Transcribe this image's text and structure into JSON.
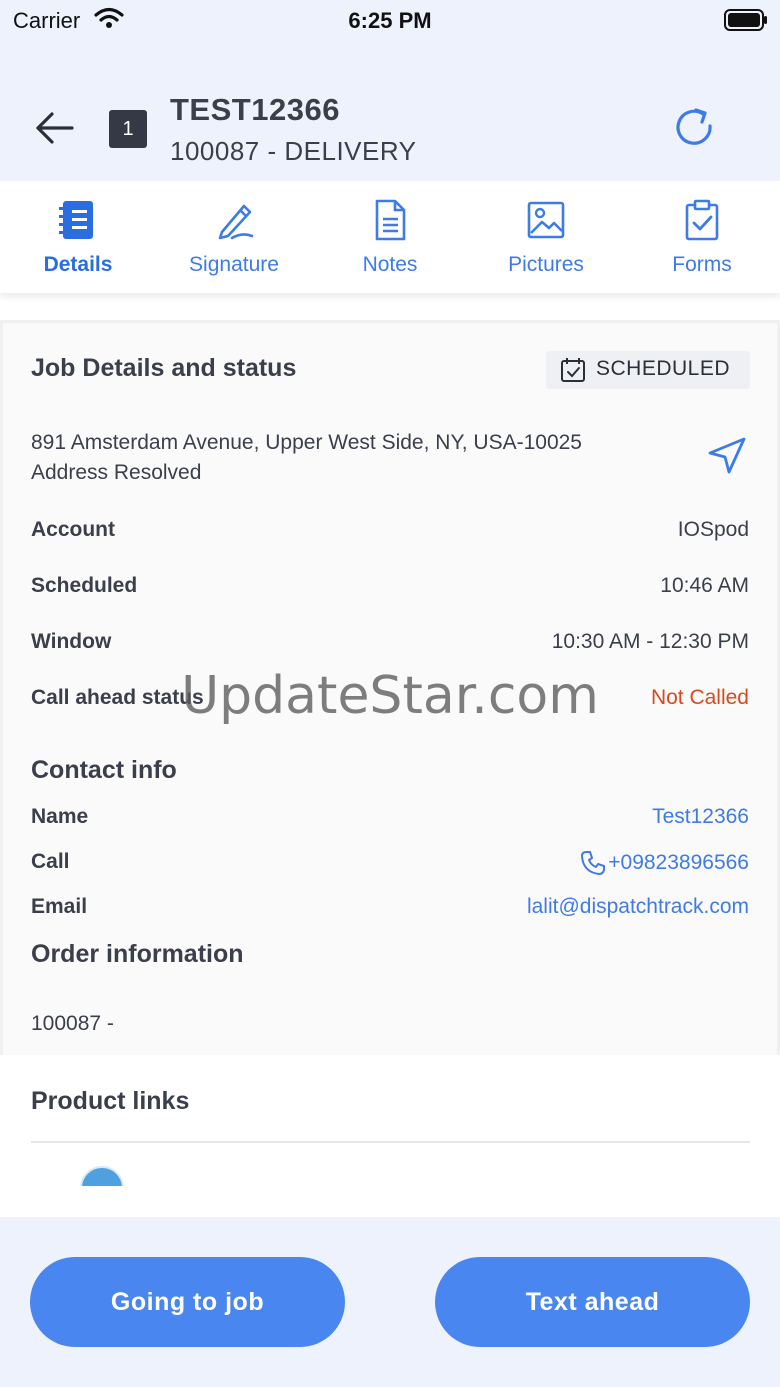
{
  "status_bar": {
    "carrier": "Carrier",
    "time": "6:25 PM"
  },
  "header": {
    "route_number": "1",
    "title": "TEST12366",
    "subtitle": "100087 - DELIVERY"
  },
  "tabs": [
    {
      "label": "Details",
      "icon": "notebook-icon",
      "active": true
    },
    {
      "label": "Signature",
      "icon": "pen-icon",
      "active": false
    },
    {
      "label": "Notes",
      "icon": "document-icon",
      "active": false
    },
    {
      "label": "Pictures",
      "icon": "image-icon",
      "active": false
    },
    {
      "label": "Forms",
      "icon": "clipboard-check-icon",
      "active": false
    }
  ],
  "job": {
    "section_title": "Job Details and status",
    "status": "SCHEDULED",
    "address_line1": "891 Amsterdam Avenue, Upper West Side, NY, USA-10025",
    "address_line2": "Address Resolved",
    "rows": [
      {
        "label": "Account",
        "value": "IOSpod"
      },
      {
        "label": "Scheduled",
        "value": "10:46 AM"
      },
      {
        "label": "Window",
        "value": "10:30 AM - 12:30 PM"
      },
      {
        "label": "Call ahead status",
        "value": "Not Called"
      }
    ]
  },
  "contact": {
    "section_title": "Contact info",
    "name_label": "Name",
    "name_value": "Test12366",
    "call_label": "Call",
    "call_value": "+09823896566",
    "email_label": "Email",
    "email_value": "lalit@dispatchtrack.com"
  },
  "order": {
    "section_title": "Order information",
    "value": "100087 -"
  },
  "product_links": {
    "section_title": "Product links"
  },
  "actions": {
    "going_to_job": "Going to job",
    "text_ahead": "Text ahead"
  },
  "watermark": "UpdateStar.com",
  "colors": {
    "accent": "#4a86f0",
    "link": "#3e7be8",
    "not_called": "#d84a1e",
    "header_bg": "#edf2fc"
  }
}
